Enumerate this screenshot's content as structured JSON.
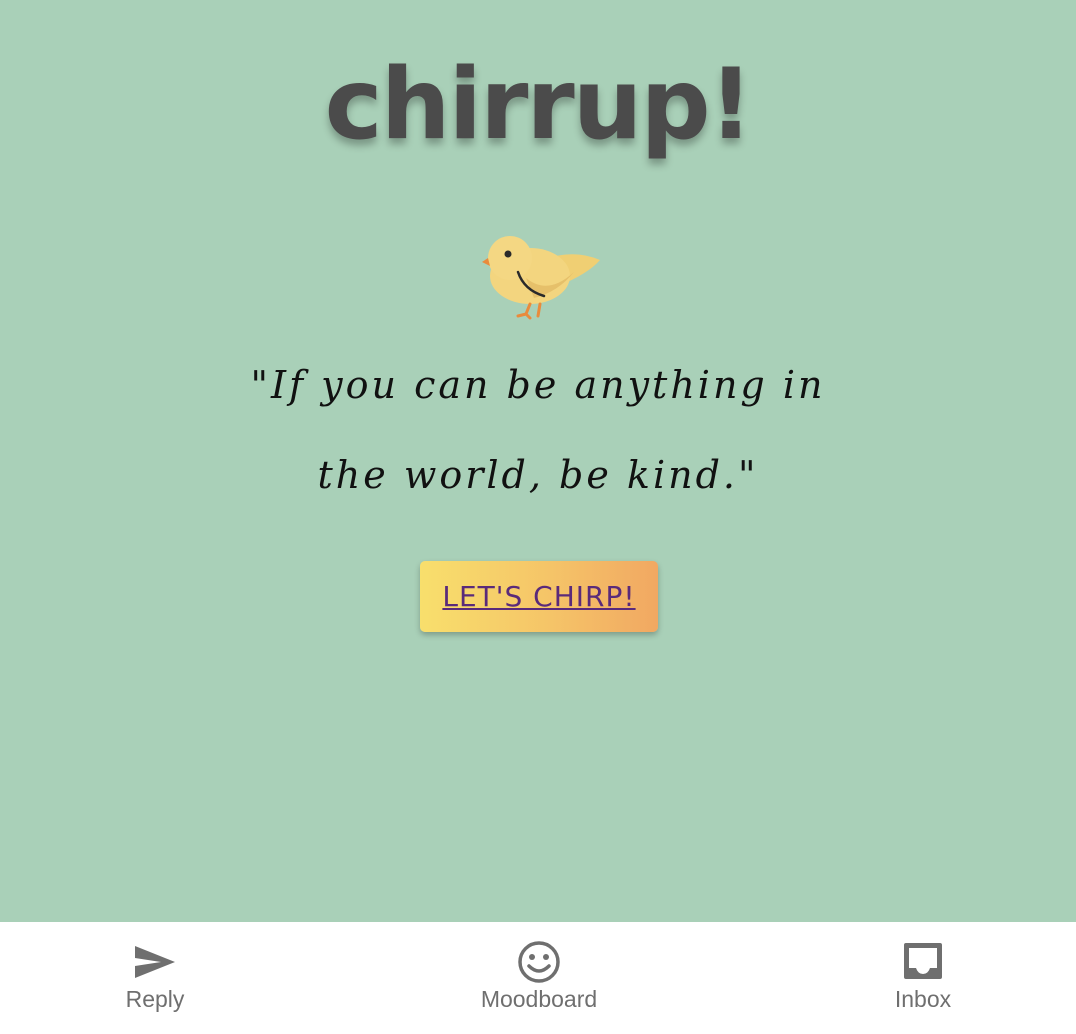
{
  "app": {
    "title": "chirrup!"
  },
  "hero": {
    "icon": "bird-icon",
    "quote_line1": "\"If you can be anything in",
    "quote_line2": "the world, be kind.\"",
    "cta_label": "LET'S CHIRP!"
  },
  "colors": {
    "background": "#a9d0b8",
    "title": "#4b4b4b",
    "cta_gradient_start": "#f8df6c",
    "cta_gradient_end": "#f1a862",
    "cta_text": "#5a2a7a",
    "nav_background": "#ffffff",
    "nav_text": "#6f6f6f"
  },
  "bottom_nav": {
    "items": [
      {
        "label": "Reply",
        "icon": "send-icon"
      },
      {
        "label": "Moodboard",
        "icon": "smiley-face-icon"
      },
      {
        "label": "Inbox",
        "icon": "inbox-icon"
      }
    ]
  }
}
